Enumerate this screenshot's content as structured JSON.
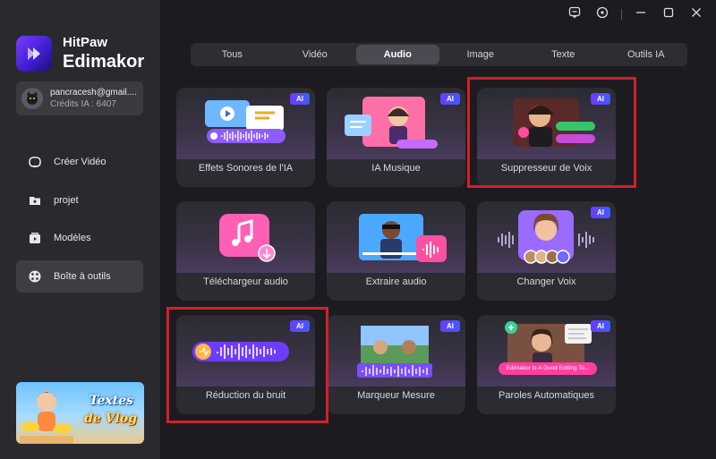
{
  "app": {
    "brand_line1": "HitPaw",
    "brand_line2": "Edimakor"
  },
  "account": {
    "email": "pancracesh@gmail....",
    "credits": "Crédits IA : 6407"
  },
  "nav": [
    {
      "label": "Créer Vidéo",
      "icon": "create-video-icon"
    },
    {
      "label": "projet",
      "icon": "folder-icon"
    },
    {
      "label": "Modèles",
      "icon": "templates-icon"
    },
    {
      "label": "Boîte à outils",
      "icon": "toolbox-icon"
    }
  ],
  "banner": {
    "line1": "Textes",
    "line2": "de Vlog"
  },
  "tabs": [
    "Tous",
    "Vidéo",
    "Audio",
    "Image",
    "Texte",
    "Outils IA"
  ],
  "active_tab": "Audio",
  "cards": [
    {
      "label": "Effets Sonores de l'IA",
      "ai": "AI"
    },
    {
      "label": "IA Musique",
      "ai": "AI"
    },
    {
      "label": "Suppresseur de Voix",
      "ai": "AI"
    },
    {
      "label": "Téléchargeur audio"
    },
    {
      "label": "Extraire audio"
    },
    {
      "label": "Changer Voix",
      "ai": "AI"
    },
    {
      "label": "Réduction du bruit",
      "ai": "AI"
    },
    {
      "label": "Marqueur Mesure",
      "ai": "AI"
    },
    {
      "label": "Paroles Automatiques",
      "ai": "AI",
      "caption": "Edimakor Is A Good Editing To..."
    }
  ],
  "colors": {
    "accent": "#7b3dff",
    "highlight": "#d31f2a",
    "ai_badge": "#5a4bff"
  }
}
